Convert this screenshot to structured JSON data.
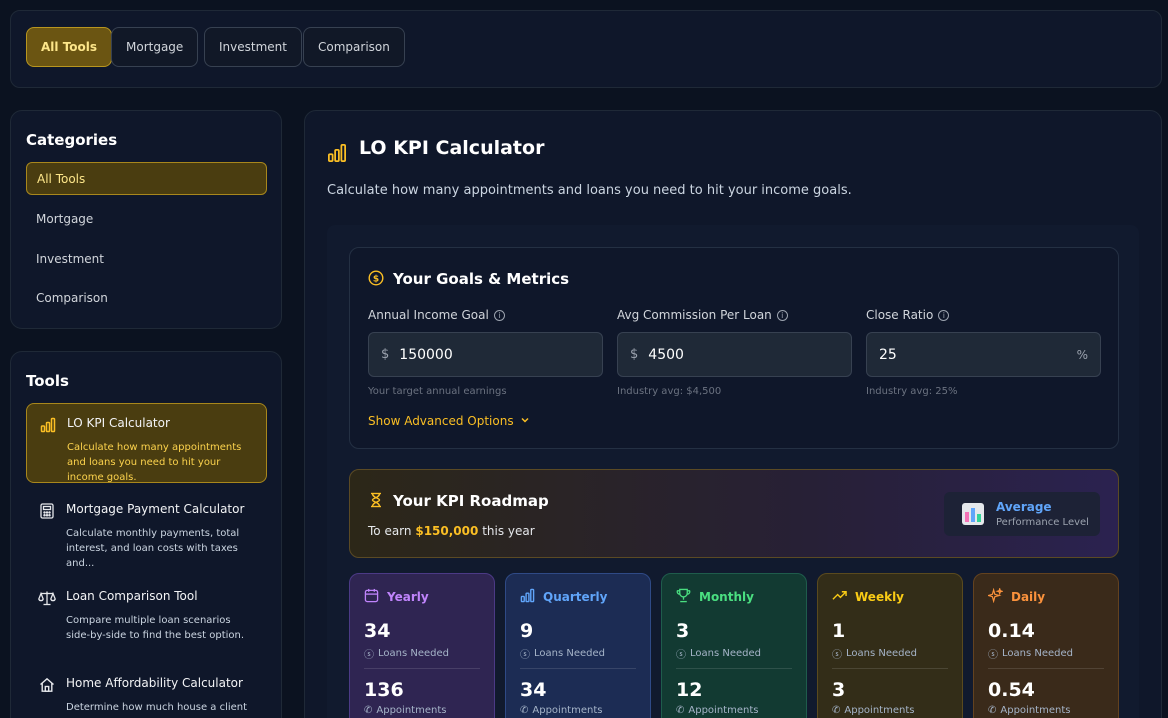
{
  "top_tabs": [
    "All Tools",
    "Mortgage",
    "Investment",
    "Comparison"
  ],
  "categories": {
    "title": "Categories",
    "items": [
      "All Tools",
      "Mortgage",
      "Investment",
      "Comparison"
    ]
  },
  "tools": {
    "title": "Tools",
    "items": [
      {
        "name": "LO KPI Calculator",
        "desc": "Calculate how many appointments and loans you need to hit your income goals."
      },
      {
        "name": "Mortgage Payment Calculator",
        "desc": "Calculate monthly payments, total interest, and loan costs with taxes and..."
      },
      {
        "name": "Loan Comparison Tool",
        "desc": "Compare multiple loan scenarios side-by-side to find the best option."
      },
      {
        "name": "Home Affordability Calculator",
        "desc": "Determine how much house a client can"
      }
    ]
  },
  "main": {
    "title": "LO KPI Calculator",
    "subtitle": "Calculate how many appointments and loans you need to hit your income goals."
  },
  "goals": {
    "title": "Your Goals & Metrics",
    "fields": [
      {
        "label": "Annual Income Goal",
        "prefix": "$",
        "value": "150000",
        "suffix": "",
        "hint": "Your target annual earnings"
      },
      {
        "label": "Avg Commission Per Loan",
        "prefix": "$",
        "value": "4500",
        "suffix": "",
        "hint": "Industry avg: $4,500"
      },
      {
        "label": "Close Ratio",
        "prefix": "",
        "value": "25",
        "suffix": "%",
        "hint": "Industry avg: 25%"
      }
    ],
    "advanced_label": "Show Advanced Options"
  },
  "roadmap": {
    "title": "Your KPI Roadmap",
    "prefix": "To earn",
    "amount": "$150,000",
    "suffix": "this year",
    "performance_level": "Average",
    "performance_caption": "Performance Level"
  },
  "periods": [
    {
      "name": "Yearly",
      "loans": "34",
      "appointments": "136",
      "color": "#c084fc"
    },
    {
      "name": "Quarterly",
      "loans": "9",
      "appointments": "34",
      "color": "#60a5fa"
    },
    {
      "name": "Monthly",
      "loans": "3",
      "appointments": "12",
      "color": "#4ade80"
    },
    {
      "name": "Weekly",
      "loans": "1",
      "appointments": "3",
      "color": "#facc15"
    },
    {
      "name": "Daily",
      "loans": "0.14",
      "appointments": "0.54",
      "color": "#fb923c"
    }
  ],
  "labels": {
    "loans_needed": "Loans Needed",
    "appointments": "Appointments"
  },
  "colors": {
    "accent": "#fbbf24",
    "background": "#0b1220"
  }
}
